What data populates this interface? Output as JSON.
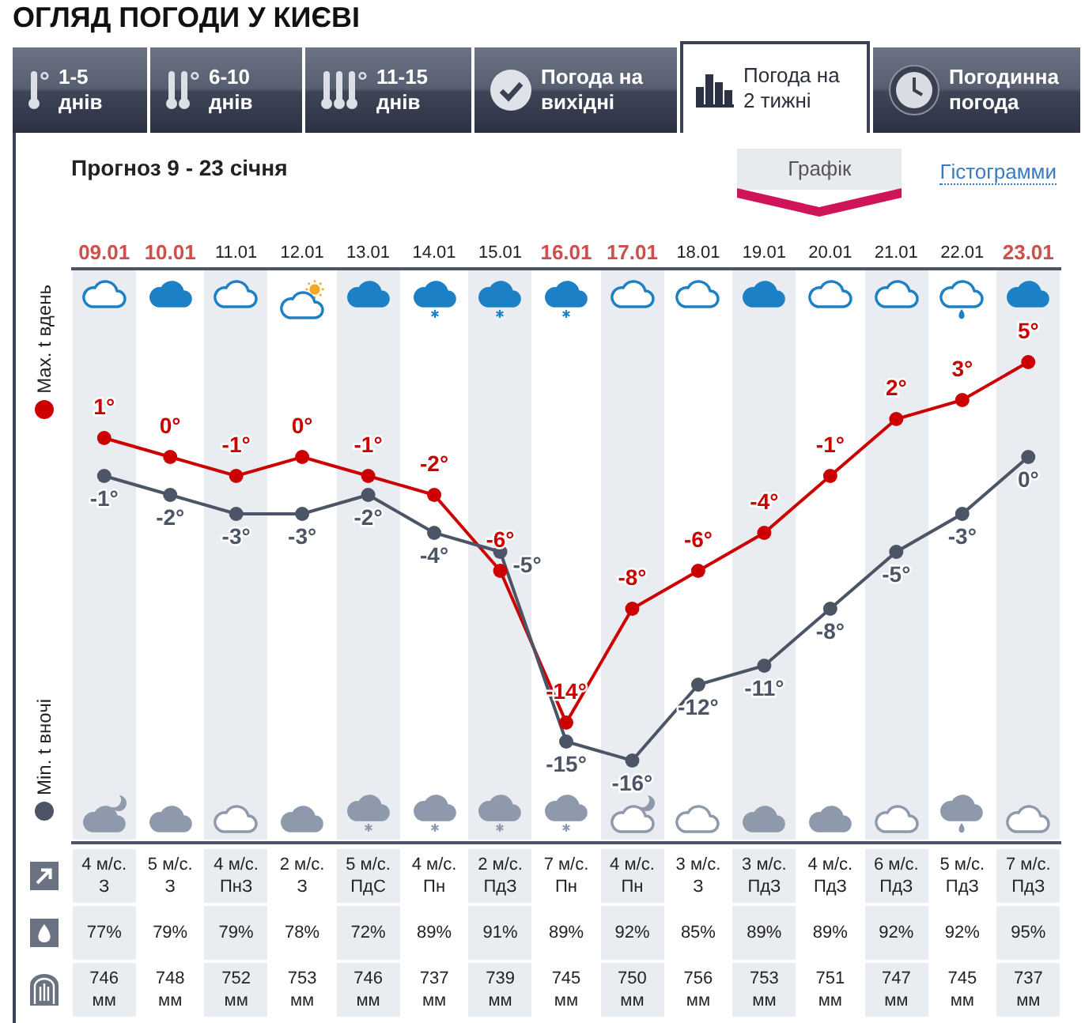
{
  "title": "ОГЛЯД ПОГОДИ У КИЄВІ",
  "tabs": [
    {
      "kind": "thermometer-1",
      "lines": [
        "1-5",
        "днів"
      ],
      "selected": false
    },
    {
      "kind": "thermometer-2",
      "lines": [
        "6-10",
        "днів"
      ],
      "selected": false
    },
    {
      "kind": "thermometer-3",
      "lines": [
        "11-15",
        "днів"
      ],
      "selected": false
    },
    {
      "kind": "check",
      "lines": [
        "Погода на",
        "вихідні"
      ],
      "selected": false
    },
    {
      "kind": "bars",
      "lines": [
        "Погода на",
        "2 тижні"
      ],
      "selected": true
    },
    {
      "kind": "clock",
      "lines": [
        "Погодинна",
        "погода"
      ],
      "selected": false
    }
  ],
  "forecast": {
    "heading": "Прогноз 9 - 23 січня",
    "views": [
      {
        "label": "Графік",
        "selected": true
      },
      {
        "label": "Гістограмми",
        "selected": false
      }
    ],
    "days": [
      {
        "date": "09.01",
        "weekend": true,
        "day_icon": {
          "kind": "cloud"
        },
        "night_icon": {
          "kind": "overcast-moon"
        },
        "wind": {
          "speed": "4 м/с.",
          "direction": "З"
        },
        "humidity": "77%",
        "pressure": {
          "value": "746",
          "unit": "мм"
        }
      },
      {
        "date": "10.01",
        "weekend": true,
        "day_icon": {
          "kind": "overcast"
        },
        "night_icon": {
          "kind": "overcast"
        },
        "wind": {
          "speed": "5 м/с.",
          "direction": "З"
        },
        "humidity": "79%",
        "pressure": {
          "value": "748",
          "unit": "мм"
        }
      },
      {
        "date": "11.01",
        "weekend": false,
        "day_icon": {
          "kind": "cloud"
        },
        "night_icon": {
          "kind": "cloud"
        },
        "wind": {
          "speed": "4 м/с.",
          "direction": "ПнЗ"
        },
        "humidity": "79%",
        "pressure": {
          "value": "752",
          "unit": "мм"
        }
      },
      {
        "date": "12.01",
        "weekend": false,
        "day_icon": {
          "kind": "cloud-sun"
        },
        "night_icon": {
          "kind": "overcast"
        },
        "wind": {
          "speed": "2 м/с.",
          "direction": "З"
        },
        "humidity": "78%",
        "pressure": {
          "value": "753",
          "unit": "мм"
        }
      },
      {
        "date": "13.01",
        "weekend": false,
        "day_icon": {
          "kind": "overcast"
        },
        "night_icon": {
          "kind": "overcast-snow"
        },
        "wind": {
          "speed": "5 м/с.",
          "direction": "ПдС"
        },
        "humidity": "72%",
        "pressure": {
          "value": "746",
          "unit": "мм"
        }
      },
      {
        "date": "14.01",
        "weekend": false,
        "day_icon": {
          "kind": "overcast-snow"
        },
        "night_icon": {
          "kind": "overcast-snow"
        },
        "wind": {
          "speed": "4 м/с.",
          "direction": "Пн"
        },
        "humidity": "89%",
        "pressure": {
          "value": "737",
          "unit": "мм"
        }
      },
      {
        "date": "15.01",
        "weekend": false,
        "day_icon": {
          "kind": "overcast-snow"
        },
        "night_icon": {
          "kind": "overcast-snow"
        },
        "wind": {
          "speed": "2 м/с.",
          "direction": "ПдЗ"
        },
        "humidity": "91%",
        "pressure": {
          "value": "739",
          "unit": "мм"
        }
      },
      {
        "date": "16.01",
        "weekend": true,
        "day_icon": {
          "kind": "overcast-snow"
        },
        "night_icon": {
          "kind": "overcast-snow"
        },
        "wind": {
          "speed": "7 м/с.",
          "direction": "Пн"
        },
        "humidity": "89%",
        "pressure": {
          "value": "745",
          "unit": "мм"
        }
      },
      {
        "date": "17.01",
        "weekend": true,
        "day_icon": {
          "kind": "cloud"
        },
        "night_icon": {
          "kind": "cloud-moon"
        },
        "wind": {
          "speed": "4 м/с.",
          "direction": "Пн"
        },
        "humidity": "92%",
        "pressure": {
          "value": "750",
          "unit": "мм"
        }
      },
      {
        "date": "18.01",
        "weekend": false,
        "day_icon": {
          "kind": "cloud"
        },
        "night_icon": {
          "kind": "cloud"
        },
        "wind": {
          "speed": "3 м/с.",
          "direction": "З"
        },
        "humidity": "85%",
        "pressure": {
          "value": "756",
          "unit": "мм"
        }
      },
      {
        "date": "19.01",
        "weekend": false,
        "day_icon": {
          "kind": "overcast"
        },
        "night_icon": {
          "kind": "overcast"
        },
        "wind": {
          "speed": "3 м/с.",
          "direction": "ПдЗ"
        },
        "humidity": "89%",
        "pressure": {
          "value": "753",
          "unit": "мм"
        }
      },
      {
        "date": "20.01",
        "weekend": false,
        "day_icon": {
          "kind": "cloud"
        },
        "night_icon": {
          "kind": "overcast"
        },
        "wind": {
          "speed": "4 м/с.",
          "direction": "ПдЗ"
        },
        "humidity": "89%",
        "pressure": {
          "value": "751",
          "unit": "мм"
        }
      },
      {
        "date": "21.01",
        "weekend": false,
        "day_icon": {
          "kind": "cloud"
        },
        "night_icon": {
          "kind": "cloud"
        },
        "wind": {
          "speed": "6 м/с.",
          "direction": "ПдЗ"
        },
        "humidity": "92%",
        "pressure": {
          "value": "747",
          "unit": "мм"
        }
      },
      {
        "date": "22.01",
        "weekend": false,
        "day_icon": {
          "kind": "cloud-rain"
        },
        "night_icon": {
          "kind": "overcast-rain"
        },
        "wind": {
          "speed": "5 м/с.",
          "direction": "ПдЗ"
        },
        "humidity": "92%",
        "pressure": {
          "value": "745",
          "unit": "мм"
        }
      },
      {
        "date": "23.01",
        "weekend": true,
        "day_icon": {
          "kind": "overcast"
        },
        "night_icon": {
          "kind": "cloud"
        },
        "wind": {
          "speed": "7 м/с.",
          "direction": "ПдЗ"
        },
        "humidity": "95%",
        "pressure": {
          "value": "737",
          "unit": "мм"
        }
      }
    ],
    "chart_data": {
      "type": "line",
      "data_labels": true,
      "series": [
        {
          "name": "Max. t вдень",
          "color": "#cc0000",
          "marker": "circle",
          "values": [
            1,
            0,
            -1,
            0,
            -1,
            -2,
            -6,
            -14,
            -8,
            -6,
            -4,
            -1,
            2,
            3,
            5
          ],
          "value_labels": [
            "1°",
            "0°",
            "-1°",
            "0°",
            "-1°",
            "-2°",
            "-6°",
            "-14°",
            "-8°",
            "-6°",
            "-4°",
            "-1°",
            "2°",
            "3°",
            "5°"
          ]
        },
        {
          "name": "Min. t вночі",
          "color": "#4b5566",
          "marker": "circle",
          "values": [
            -1,
            -2,
            -3,
            -3,
            -2,
            -4,
            -5,
            -15,
            -16,
            -12,
            -11,
            -8,
            -5,
            -3,
            0
          ],
          "value_labels": [
            "-1°",
            "-2°",
            "-3°",
            "-3°",
            "-2°",
            "-4°",
            "-5°",
            "-15°",
            "-16°",
            "-12°",
            "-11°",
            "-8°",
            "-5°",
            "-3°",
            "0°"
          ]
        }
      ]
    }
  }
}
